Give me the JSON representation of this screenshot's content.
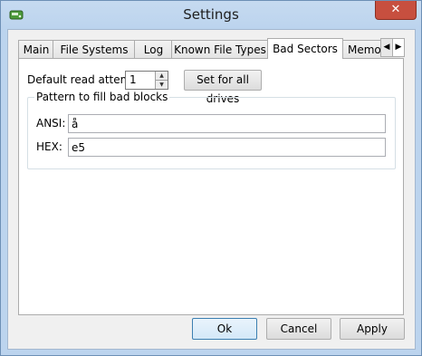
{
  "window": {
    "title": "Settings",
    "icon": "app-drive-icon",
    "close_label": "✕"
  },
  "tabs": [
    {
      "label": "Main"
    },
    {
      "label": "File Systems"
    },
    {
      "label": "Log"
    },
    {
      "label": "Known File Types"
    },
    {
      "label": "Bad Sectors"
    },
    {
      "label": "Memo"
    }
  ],
  "active_tab": "Bad Sectors",
  "tab_scroll": {
    "left": "◀",
    "right": "▶"
  },
  "bad_sectors": {
    "read_attempts_label": "Default read attempts:",
    "read_attempts_value": "1",
    "set_all_label": "Set for all drives",
    "pattern_group_label": "Pattern to fill bad blocks",
    "ansi_label": "ANSI:",
    "ansi_value": "å",
    "hex_label": "HEX:",
    "hex_value": "e5"
  },
  "buttons": {
    "ok": "Ok",
    "cancel": "Cancel",
    "apply": "Apply"
  }
}
